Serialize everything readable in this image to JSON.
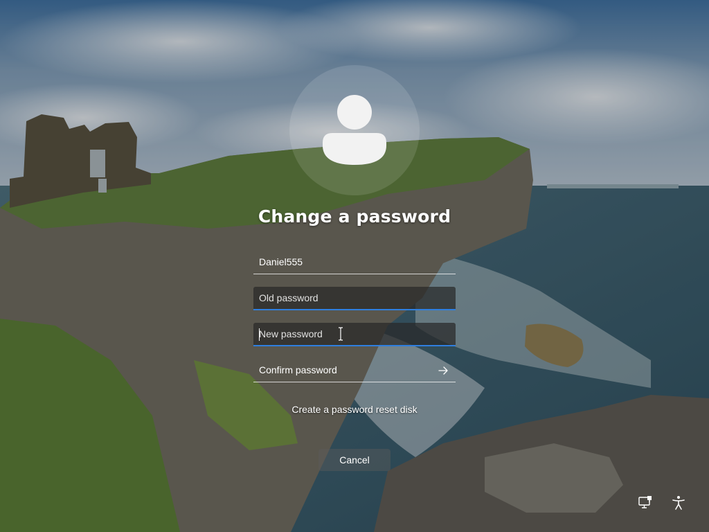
{
  "screen": {
    "title": "Change a password",
    "avatar_icon": "user-avatar-icon"
  },
  "form": {
    "username_value": "Daniel555",
    "old_password_placeholder": "Old password",
    "new_password_placeholder": "New password",
    "confirm_password_placeholder": "Confirm password",
    "submit_icon": "arrow-right-icon",
    "focused_field": "new_password"
  },
  "links": {
    "reset_disk_label": "Create a password reset disk"
  },
  "buttons": {
    "cancel_label": "Cancel"
  },
  "corner_icons": {
    "network": "network-icon",
    "accessibility": "accessibility-icon"
  },
  "colors": {
    "accent": "#2f7fe0",
    "text": "#ffffff"
  }
}
